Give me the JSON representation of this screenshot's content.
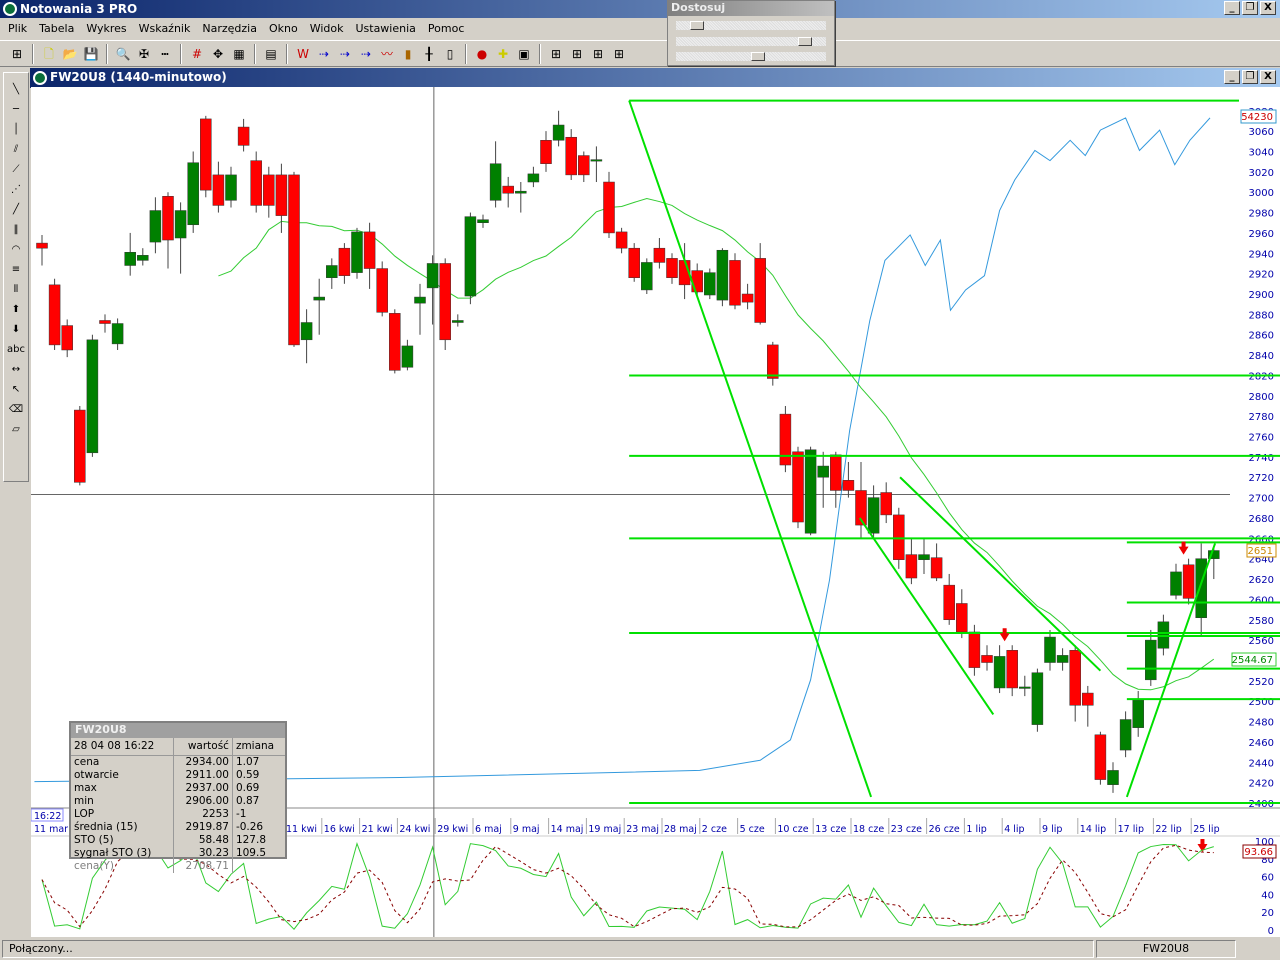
{
  "app": {
    "title": "Notowania 3 PRO",
    "controls": [
      "_",
      "❐",
      "X"
    ]
  },
  "menu": [
    "Plik",
    "Tabela",
    "Wykres",
    "Wskaźnik",
    "Narzędzia",
    "Okno",
    "Widok",
    "Ustawienia",
    "Pomoc"
  ],
  "toolbar_icons": [
    "grid-icon",
    "new-file-icon",
    "open-folder-icon",
    "save-icon",
    "zoom-icon",
    "crosshair-icon",
    "ruler-icon",
    "numbers-icon",
    "move-icon",
    "select-icon",
    "table-icon",
    "wl-icon",
    "arrow-line-icon",
    "arrow-line-2-icon",
    "arrow-line-3-icon",
    "line-chart-icon",
    "bar-chart-icon",
    "ohlc-icon",
    "candle-icon",
    "signal-icon",
    "add-marker-icon",
    "add-window-icon",
    "layout-1-icon",
    "layout-2-icon",
    "layout-3-icon",
    "layout-4-icon"
  ],
  "adjust_panel": {
    "title": "Dostosuj",
    "sliders": [
      0.1,
      0.9,
      0.55
    ]
  },
  "palette_icons": [
    "line",
    "hline",
    "vline",
    "parallel",
    "ray",
    "fan",
    "segment",
    "channel",
    "arcs",
    "fib",
    "vgrid",
    "up-arrow",
    "down-arrow",
    "abc",
    "hand",
    "pointer",
    "eraser",
    "clear"
  ],
  "palette_text": "abc",
  "chart_window": {
    "title": "FW20U8 (1440-minutowo)"
  },
  "info_box": {
    "title": "FW20U8",
    "date": "28 04 08 16:22",
    "col_value": "wartość",
    "col_change": "zmiana",
    "rows": [
      [
        "cena",
        "2934.00",
        "1.07"
      ],
      [
        "otwarcie",
        "2911.00",
        "0.59"
      ],
      [
        "max",
        "2937.00",
        "0.69"
      ],
      [
        "min",
        "2906.00",
        "0.87"
      ],
      [
        "LOP",
        "2253",
        "-1"
      ],
      [
        "średnia (15)",
        "2919.87",
        "-0.26"
      ],
      [
        "STO (5)",
        "58.48",
        "127.8"
      ],
      [
        "sygnał STO (3)",
        "30.23",
        "109.5"
      ],
      [
        "cena(Y)",
        "2708.71",
        ""
      ]
    ]
  },
  "status": {
    "left": "Połączony...",
    "right": "FW20U8"
  },
  "colors": {
    "up": "#008000",
    "down": "#ff0000",
    "ma": "#33cc33",
    "lop": "#3399dd",
    "lines": "#00e000",
    "axis": "#0000aa"
  },
  "chart_data": {
    "type": "candlestick",
    "price_axis": {
      "min": 2400,
      "max": 3080,
      "step": 20
    },
    "sto_axis": {
      "ticks": [
        0,
        20,
        40,
        60,
        80,
        100
      ]
    },
    "crosshair": {
      "index": 31.1,
      "price": 2703,
      "time": "16:22",
      "date": "11 mar"
    },
    "date_labels": [
      "11 kwi",
      "16 kwi",
      "21 kwi",
      "24 kwi",
      "29 kwi",
      "6 maj",
      "9 maj",
      "14 maj",
      "19 maj",
      "23 maj",
      "28 maj",
      "2 cze",
      "5 cze",
      "10 cze",
      "13 cze",
      "18 cze",
      "23 cze",
      "26 cze",
      "1 lip",
      "4 lip",
      "9 lip",
      "14 lip",
      "17 lip",
      "22 lip",
      "25 lip"
    ],
    "candles": [
      [
        2950,
        2958,
        2928,
        2945
      ],
      [
        2909,
        2915,
        2845,
        2850
      ],
      [
        2869,
        2875,
        2838,
        2845
      ],
      [
        2786,
        2790,
        2712,
        2715
      ],
      [
        2744,
        2860,
        2740,
        2855
      ],
      [
        2874,
        2880,
        2862,
        2871
      ],
      [
        2851,
        2876,
        2845,
        2871
      ],
      [
        2928,
        2960,
        2918,
        2941
      ],
      [
        2933,
        2945,
        2928,
        2938
      ],
      [
        2951,
        2995,
        2940,
        2982
      ],
      [
        2996,
        3000,
        2925,
        2953
      ],
      [
        2955,
        2990,
        2920,
        2982
      ],
      [
        2968,
        3040,
        2960,
        3029
      ],
      [
        3072,
        3075,
        2995,
        3002
      ],
      [
        3017,
        3030,
        2980,
        2987
      ],
      [
        2992,
        3025,
        2985,
        3017
      ],
      [
        3064,
        3072,
        3040,
        3046
      ],
      [
        3031,
        3040,
        2980,
        2987
      ],
      [
        3017,
        3025,
        2975,
        2987
      ],
      [
        3017,
        3028,
        2960,
        2977
      ],
      [
        3017,
        3020,
        2848,
        2850
      ],
      [
        2855,
        2885,
        2832,
        2872
      ],
      [
        2894,
        2915,
        2860,
        2897
      ],
      [
        2916,
        2935,
        2905,
        2928
      ],
      [
        2945,
        2950,
        2910,
        2918
      ],
      [
        2921,
        2965,
        2915,
        2961
      ],
      [
        2961,
        2970,
        2905,
        2925
      ],
      [
        2925,
        2932,
        2878,
        2882
      ],
      [
        2881,
        2885,
        2822,
        2825
      ],
      [
        2828,
        2855,
        2825,
        2849
      ],
      [
        2891,
        2910,
        2860,
        2897
      ],
      [
        2906,
        2938,
        2870,
        2930
      ],
      [
        2930,
        2935,
        2845,
        2855
      ],
      [
        2872,
        2880,
        2868,
        2874
      ],
      [
        2898,
        2980,
        2890,
        2976
      ],
      [
        2970,
        2978,
        2965,
        2973
      ],
      [
        2992,
        3050,
        2985,
        3028
      ],
      [
        3006,
        3015,
        2985,
        2999
      ],
      [
        2999,
        3010,
        2980,
        3001
      ],
      [
        3010,
        3025,
        3005,
        3018
      ],
      [
        3051,
        3060,
        3020,
        3028
      ],
      [
        3051,
        3080,
        3045,
        3066
      ],
      [
        3054,
        3062,
        3012,
        3017
      ],
      [
        3036,
        3040,
        3010,
        3017
      ],
      [
        3031,
        3045,
        3010,
        3032
      ],
      [
        3010,
        3020,
        2955,
        2960
      ],
      [
        2961,
        2965,
        2940,
        2945
      ],
      [
        2945,
        2950,
        2912,
        2916
      ],
      [
        2904,
        2935,
        2900,
        2931
      ],
      [
        2945,
        2955,
        2925,
        2931
      ],
      [
        2935,
        2940,
        2910,
        2916
      ],
      [
        2933,
        2950,
        2895,
        2909
      ],
      [
        2923,
        2930,
        2898,
        2902
      ],
      [
        2899,
        2925,
        2895,
        2921
      ],
      [
        2894,
        2945,
        2888,
        2943
      ],
      [
        2933,
        2940,
        2885,
        2889
      ],
      [
        2900,
        2910,
        2885,
        2892
      ],
      [
        2935,
        2950,
        2870,
        2872
      ],
      [
        2850,
        2853,
        2810,
        2817
      ],
      [
        2782,
        2790,
        2725,
        2732
      ],
      [
        2745,
        2750,
        2670,
        2676
      ],
      [
        2665,
        2750,
        2663,
        2747
      ],
      [
        2720,
        2745,
        2690,
        2731
      ],
      [
        2742,
        2745,
        2690,
        2707
      ],
      [
        2717,
        2735,
        2700,
        2707
      ],
      [
        2707,
        2735,
        2660,
        2673
      ],
      [
        2665,
        2712,
        2660,
        2700
      ],
      [
        2705,
        2715,
        2675,
        2683
      ],
      [
        2683,
        2690,
        2630,
        2639
      ],
      [
        2644,
        2660,
        2615,
        2621
      ],
      [
        2639,
        2660,
        2625,
        2644
      ],
      [
        2641,
        2655,
        2618,
        2621
      ],
      [
        2614,
        2625,
        2575,
        2580
      ],
      [
        2596,
        2610,
        2562,
        2568
      ],
      [
        2568,
        2575,
        2525,
        2533
      ],
      [
        2545,
        2555,
        2530,
        2538
      ],
      [
        2513,
        2555,
        2508,
        2544
      ],
      [
        2550,
        2555,
        2505,
        2513
      ],
      [
        2513,
        2525,
        2505,
        2514
      ],
      [
        2477,
        2532,
        2470,
        2528
      ],
      [
        2538,
        2570,
        2530,
        2563
      ],
      [
        2538,
        2552,
        2530,
        2545
      ],
      [
        2550,
        2555,
        2480,
        2496
      ],
      [
        2508,
        2515,
        2475,
        2496
      ],
      [
        2467,
        2470,
        2418,
        2423
      ],
      [
        2418,
        2440,
        2410,
        2432
      ],
      [
        2452,
        2490,
        2445,
        2482
      ],
      [
        2474,
        2510,
        2465,
        2501
      ],
      [
        2521,
        2570,
        2515,
        2560
      ],
      [
        2552,
        2585,
        2545,
        2578
      ],
      [
        2604,
        2635,
        2600,
        2627
      ],
      [
        2634,
        2640,
        2595,
        2601
      ],
      [
        2582,
        2655,
        2565,
        2640
      ],
      [
        2640,
        2652,
        2620,
        2648
      ]
    ],
    "ma_period": 15,
    "lop_series": [
      [
        -0.6,
        2421
      ],
      [
        28.4,
        2425
      ],
      [
        52.2,
        2432
      ],
      [
        57,
        2442
      ],
      [
        59.4,
        2462
      ],
      [
        61,
        2521
      ],
      [
        62.5,
        2619
      ],
      [
        64.1,
        2766
      ],
      [
        65.7,
        2874
      ],
      [
        66.9,
        2933
      ],
      [
        68.9,
        2958
      ],
      [
        70.1,
        2928
      ],
      [
        71.3,
        2953
      ],
      [
        72.1,
        2884
      ],
      [
        73.3,
        2904
      ],
      [
        74.8,
        2918
      ],
      [
        76,
        2982
      ],
      [
        77.2,
        3012
      ],
      [
        78.8,
        3041
      ],
      [
        80,
        3031
      ],
      [
        81.6,
        3051
      ],
      [
        82.8,
        3036
      ],
      [
        84,
        3061
      ],
      [
        86,
        3073
      ],
      [
        87.1,
        3041
      ],
      [
        88.7,
        3061
      ],
      [
        89.9,
        3027
      ],
      [
        91.1,
        3051
      ],
      [
        92.7,
        3073
      ]
    ],
    "hlines": [
      {
        "price": 2820,
        "from": 46.6
      },
      {
        "price": 2741,
        "from": 46.6
      },
      {
        "price": 2660,
        "from": 46.6
      },
      {
        "price": 2567,
        "from": 46.6
      },
      {
        "price": 2400,
        "from": 46.6
      },
      {
        "price": 2656,
        "from": 86.1
      },
      {
        "price": 2597,
        "from": 86.1
      },
      {
        "price": 2564,
        "from": 86.1
      },
      {
        "price": 2532,
        "from": 86.1
      },
      {
        "price": 2502,
        "from": 86.1
      }
    ],
    "trendlines": [
      [
        46.6,
        3090,
        95,
        3090
      ],
      [
        46.6,
        3090,
        65.8,
        2406
      ],
      [
        68.1,
        2720,
        84,
        2530
      ],
      [
        64.9,
        2680,
        75.5,
        2487
      ],
      [
        86.1,
        2406,
        93.1,
        2655
      ]
    ],
    "arrows_price": [
      76.4,
      90.6
    ],
    "arrow_sto": 92.1,
    "labels": {
      "lop": "54230",
      "price": "2651",
      "ma": "2544.67",
      "sto": "93.66"
    },
    "sto_period": 5,
    "sto_signal": 3
  }
}
